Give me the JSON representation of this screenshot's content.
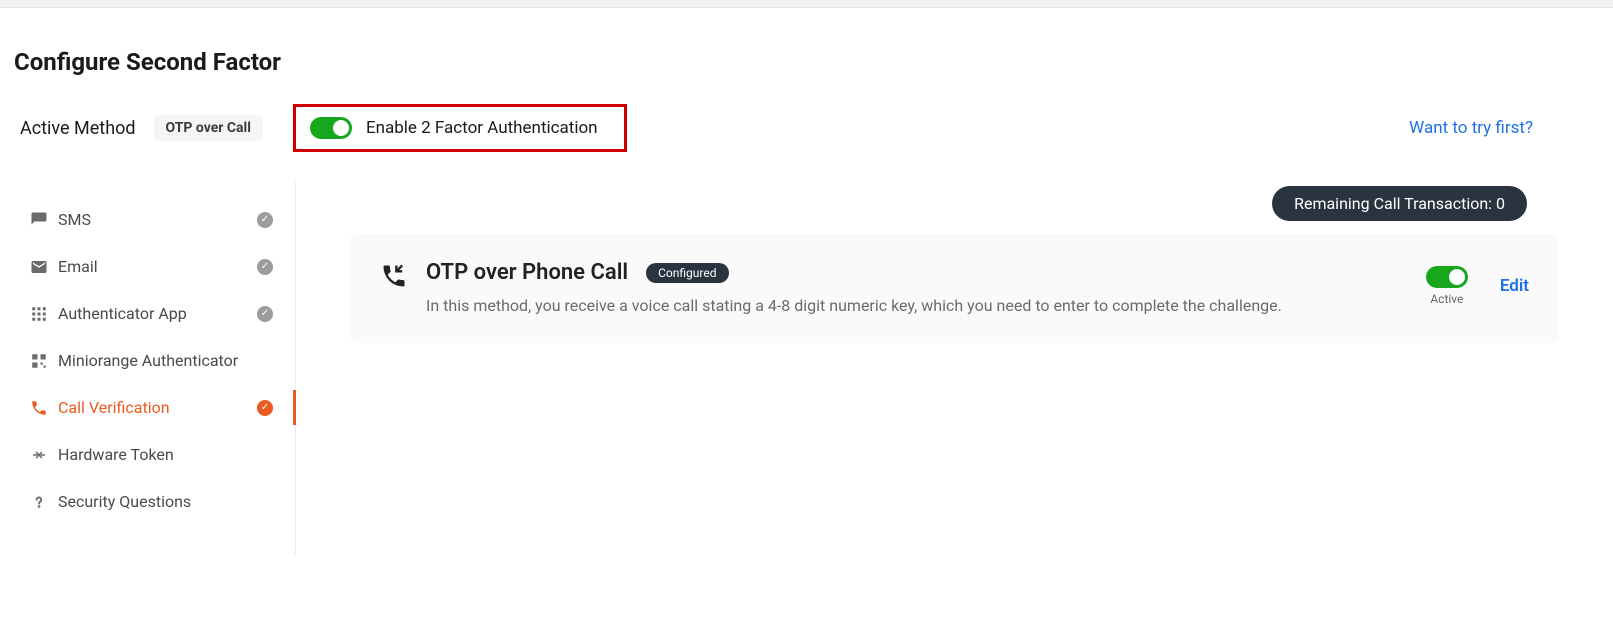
{
  "page": {
    "title": "Configure Second Factor",
    "active_method_label": "Active Method",
    "active_method_value": "OTP over Call",
    "enable_2fa_label": "Enable 2 Factor Authentication",
    "try_first": "Want to try first?"
  },
  "sidebar": {
    "items": [
      {
        "id": "sms",
        "label": "SMS",
        "configured": true,
        "active": false
      },
      {
        "id": "email",
        "label": "Email",
        "configured": true,
        "active": false
      },
      {
        "id": "authenticator-app",
        "label": "Authenticator App",
        "configured": true,
        "active": false
      },
      {
        "id": "miniorange-auth",
        "label": "Miniorange Authenticator",
        "configured": false,
        "active": false
      },
      {
        "id": "call-verification",
        "label": "Call Verification",
        "configured": true,
        "active": true
      },
      {
        "id": "hardware-token",
        "label": "Hardware Token",
        "configured": false,
        "active": false
      },
      {
        "id": "security-questions",
        "label": "Security Questions",
        "configured": false,
        "active": false
      }
    ]
  },
  "content": {
    "remaining_label": "Remaining Call Transaction: 0",
    "method": {
      "title": "OTP over Phone Call",
      "status_badge": "Configured",
      "description": "In this method, you receive a voice call stating a 4-8 digit numeric key, which you need to enter to complete the challenge.",
      "active_caption": "Active",
      "edit_label": "Edit"
    }
  },
  "colors": {
    "accent": "#eb5a1e",
    "link": "#1f6fe7",
    "toggle_on": "#18a61d",
    "pill_dark": "#2a3440",
    "highlight_border": "#cc0000"
  }
}
